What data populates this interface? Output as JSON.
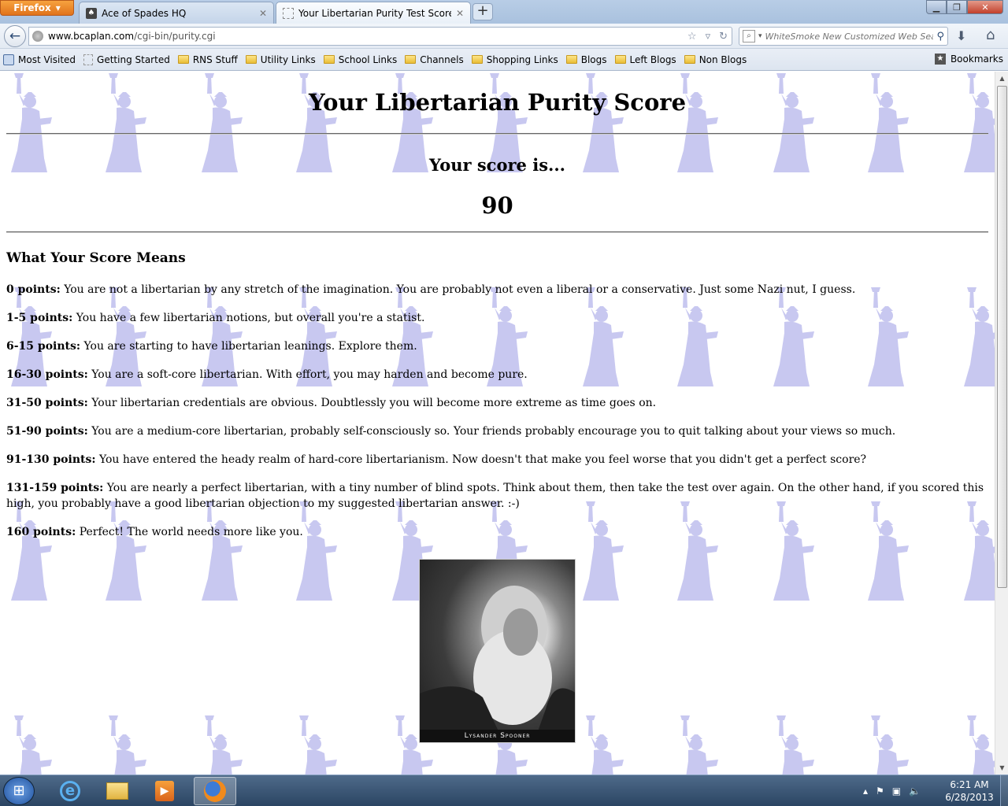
{
  "browser": {
    "menu_button": "Firefox",
    "tabs": [
      {
        "title": "Ace of Spades HQ",
        "favicon": "ace-of-spades-favicon"
      },
      {
        "title": "Your Libertarian Purity Test Score",
        "favicon": "blank-page-favicon"
      }
    ],
    "url_domain": "www.bcaplan.com",
    "url_path": "/cgi-bin/purity.cgi",
    "search_placeholder": "WhiteSmoke New Customized Web Sear",
    "bookmarks": [
      {
        "label": "Most Visited",
        "icon": "most-visited-icon"
      },
      {
        "label": "Getting Started",
        "icon": "page-icon"
      },
      {
        "label": "RNS Stuff",
        "icon": "folder-icon"
      },
      {
        "label": "Utility Links",
        "icon": "folder-icon"
      },
      {
        "label": "School Links",
        "icon": "folder-icon"
      },
      {
        "label": "Channels",
        "icon": "folder-icon"
      },
      {
        "label": "Shopping Links",
        "icon": "folder-icon"
      },
      {
        "label": "Blogs",
        "icon": "folder-icon"
      },
      {
        "label": "Left Blogs",
        "icon": "folder-icon"
      },
      {
        "label": "Non Blogs",
        "icon": "folder-icon"
      }
    ],
    "bookmarks_menu": "Bookmarks"
  },
  "page": {
    "title": "Your Libertarian Purity Score",
    "score_heading": "Your score is...",
    "score": "90",
    "means_heading": "What Your Score Means",
    "ranges": [
      {
        "range": "0 points:",
        "text": " You are not a libertarian by any stretch of the imagination. You are probably not even a liberal or a conservative. Just some Nazi nut, I guess."
      },
      {
        "range": "1-5 points:",
        "text": " You have a few libertarian notions, but overall you're a statist."
      },
      {
        "range": "6-15 points:",
        "text": " You are starting to have libertarian leanings. Explore them."
      },
      {
        "range": "16-30 points:",
        "text": " You are a soft-core libertarian. With effort, you may harden and become pure."
      },
      {
        "range": "31-50 points:",
        "text": " Your libertarian credentials are obvious. Doubtlessly you will become more extreme as time goes on."
      },
      {
        "range": "51-90 points:",
        "text": " You are a medium-core libertarian, probably self-consciously so. Your friends probably encourage you to quit talking about your views so much."
      },
      {
        "range": "91-130 points:",
        "text": " You have entered the heady realm of hard-core libertarianism. Now doesn't that make you feel worse that you didn't get a perfect score?"
      },
      {
        "range": "131-159 points:",
        "text": " You are nearly a perfect libertarian, with a tiny number of blind spots. Think about them, then take the test over again. On the other hand, if you scored this high, you probably have a good libertarian objection to my suggested libertarian answer. :-)"
      },
      {
        "range": "160 points:",
        "text": " Perfect! The world needs more like you."
      }
    ],
    "portrait_caption": "Lysander Spooner",
    "background_tint": "#c8c8f0"
  },
  "taskbar": {
    "time": "6:21 AM",
    "date": "6/28/2013",
    "pinned": [
      "internet-explorer-icon",
      "windows-explorer-icon",
      "media-player-icon",
      "firefox-icon"
    ]
  }
}
